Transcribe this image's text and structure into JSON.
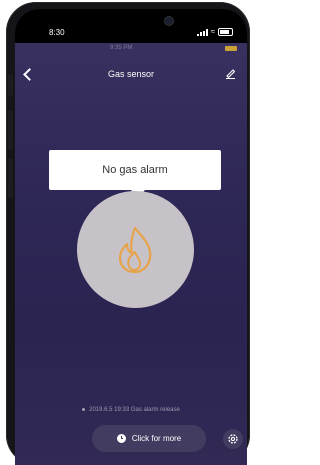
{
  "status_bar": {
    "time": "8:30"
  },
  "ghost_status": {
    "time": "9:35 PM"
  },
  "nav": {
    "title": "Gas sensor"
  },
  "alarm": {
    "status_text": "No gas alarm",
    "icon": "flame-icon",
    "icon_color": "#e7a34a"
  },
  "history": {
    "entry": "2019.6.5 19:33 Gas alarm release"
  },
  "actions": {
    "more_label": "Click for more"
  },
  "colors": {
    "background_top": "#3b3260",
    "background_bottom": "#2b2350",
    "button_fill": "#433c61",
    "circle_fill": "#c7c2c8"
  }
}
